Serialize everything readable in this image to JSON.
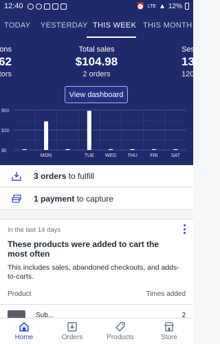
{
  "status_bar": {
    "time": "12:40",
    "battery": "12%",
    "network": "LTE"
  },
  "tabs": [
    {
      "label": "TODAY",
      "active": false
    },
    {
      "label": "YESTERDAY",
      "active": false
    },
    {
      "label": "THIS WEEK",
      "active": true
    },
    {
      "label": "THIS MONTH",
      "active": false
    }
  ],
  "metrics": {
    "left": {
      "label": "ons",
      "value": "62",
      "sub": "tors"
    },
    "center": {
      "label": "Total sales",
      "value": "$104.98",
      "sub": "2 orders"
    },
    "right": {
      "label": "Ses",
      "value": "13",
      "sub": "120"
    }
  },
  "view_dashboard_label": "View dashboard",
  "chart_data": {
    "type": "bar",
    "title": "",
    "xlabel": "",
    "ylabel": "",
    "y_ticks": [
      "$60",
      "$30",
      "$0"
    ],
    "ylim": [
      0,
      60
    ],
    "grid": true,
    "categories": [
      "",
      "MON",
      "",
      "TUE",
      "WED",
      "THU",
      "FRI",
      "SAT"
    ],
    "values": [
      0,
      43,
      0,
      59,
      0,
      0,
      0,
      0
    ]
  },
  "tasks": {
    "fulfill": {
      "bold": "3 orders",
      "rest": " to fulfill"
    },
    "capture": {
      "bold": "1 payment",
      "rest": " to capture"
    }
  },
  "card": {
    "eyebrow": "In the last 14 days",
    "title": "These products were added to cart the most often",
    "description": "This includes sales, abandoned checkouts, and adds-to-carts.",
    "col_product": "Product",
    "col_times": "Times added",
    "row": {
      "name": "Sub...",
      "value": "2"
    }
  },
  "nav": [
    {
      "label": "Home",
      "icon": "home-icon",
      "active": true
    },
    {
      "label": "Orders",
      "icon": "orders-icon",
      "active": false
    },
    {
      "label": "Products",
      "icon": "products-tag-icon",
      "active": false
    },
    {
      "label": "Store",
      "icon": "store-icon",
      "active": false
    }
  ],
  "colors": {
    "header_bg": "#1f2a6b",
    "accent": "#2f45b6",
    "bar": "#ffffff"
  }
}
